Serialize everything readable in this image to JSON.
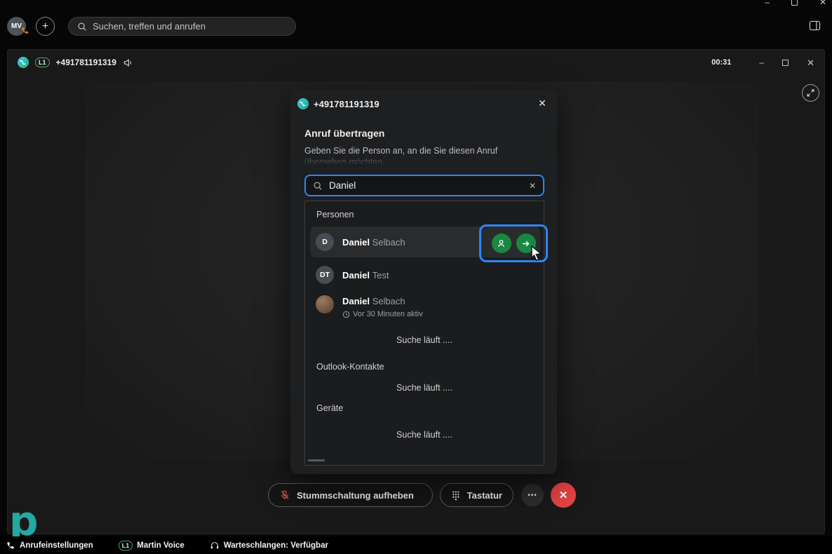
{
  "app": {
    "avatar_initials": "MV",
    "search_placeholder": "Suchen, treffen und anrufen"
  },
  "call_window": {
    "line_badge": "L1",
    "phone_number": "+491781191319",
    "timer": "00:31"
  },
  "modal": {
    "phone_number": "+491781191319",
    "title": "Anruf übertragen",
    "subtitle_line1": "Geben Sie die Person an, an die Sie diesen Anruf",
    "subtitle_line2": "übergeben möchten.",
    "search_value": "Daniel",
    "searching_text": "Suche läuft ....",
    "sections": {
      "people": "Personen",
      "outlook": "Outlook-Kontakte",
      "devices": "Geräte"
    },
    "results": [
      {
        "initials": "D",
        "first": "Daniel",
        "last": "Selbach"
      },
      {
        "initials": "DT",
        "first": "Daniel",
        "last": "Test"
      },
      {
        "initials": "",
        "first": "Daniel",
        "last": "Selbach",
        "status": "Vor 30 Minuten aktiv"
      }
    ]
  },
  "controls": {
    "unmute_label": "Stummschaltung aufheben",
    "keypad_label": "Tastatur"
  },
  "statusbar": {
    "call_settings": "Anrufeinstellungen",
    "line_badge": "L1",
    "line_name": "Martin Voice",
    "queues": "Warteschlangen: Verfügbar"
  },
  "icons": {
    "plus": "+",
    "minimize": "–",
    "close": "✕",
    "clear": "✕",
    "ellipsis": "•••"
  },
  "colors": {
    "accent": "#2E86F7",
    "green": "#1A8742",
    "red": "#E34242",
    "mic-red": "#E0524C",
    "teal": "#23A8A2",
    "badge-green": "#3FAE63"
  }
}
